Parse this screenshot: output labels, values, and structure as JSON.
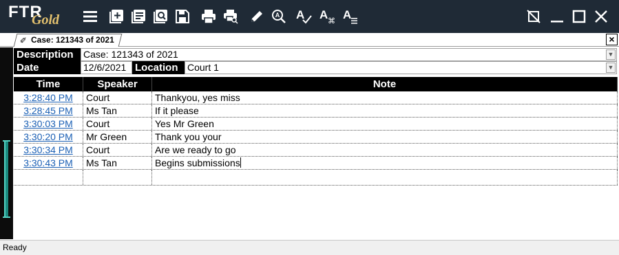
{
  "app": {
    "logo_main": "FTR",
    "logo_sub": "Gold"
  },
  "toolbar": {
    "icons": [
      "menu-icon",
      "add-note-icon",
      "notes-list-icon",
      "preview-icon",
      "save-icon",
      "print-icon",
      "print-preview-icon",
      "edit-icon",
      "find-icon",
      "spell-check-icon",
      "shortcuts-icon",
      "text-list-icon"
    ],
    "window_controls": [
      "disconnect-icon",
      "minimize-icon",
      "maximize-icon",
      "close-icon"
    ]
  },
  "tab": {
    "label": "Case: 121343 of 2021",
    "icon": "leaf-icon"
  },
  "header": {
    "description_label": "Description",
    "description_value": "Case: 121343 of 2021",
    "date_label": "Date",
    "date_value": "12/6/2021",
    "location_label": "Location",
    "location_value": "Court 1"
  },
  "table": {
    "columns": {
      "time": "Time",
      "speaker": "Speaker",
      "note": "Note"
    },
    "rows": [
      {
        "time": "3:28:40 PM",
        "speaker": "Court",
        "note": "Thankyou, yes miss"
      },
      {
        "time": "3:28:45 PM",
        "speaker": "Ms Tan",
        "note": "If it please"
      },
      {
        "time": "3:30:03 PM",
        "speaker": "Court",
        "note": "Yes Mr Green"
      },
      {
        "time": "3:30:20 PM",
        "speaker": "Mr Green",
        "note": "Thank you your"
      },
      {
        "time": "3:30:34 PM",
        "speaker": "Court",
        "note": "Are we ready to go"
      },
      {
        "time": "3:30:43 PM",
        "speaker": "Ms Tan",
        "note": "Begins submissions"
      }
    ]
  },
  "status": {
    "text": "Ready"
  },
  "colors": {
    "titlebar": "#1f2a36",
    "logo_gold": "#e3c16e",
    "time_link": "#1a5fb4",
    "marker": "#1b8a80"
  }
}
